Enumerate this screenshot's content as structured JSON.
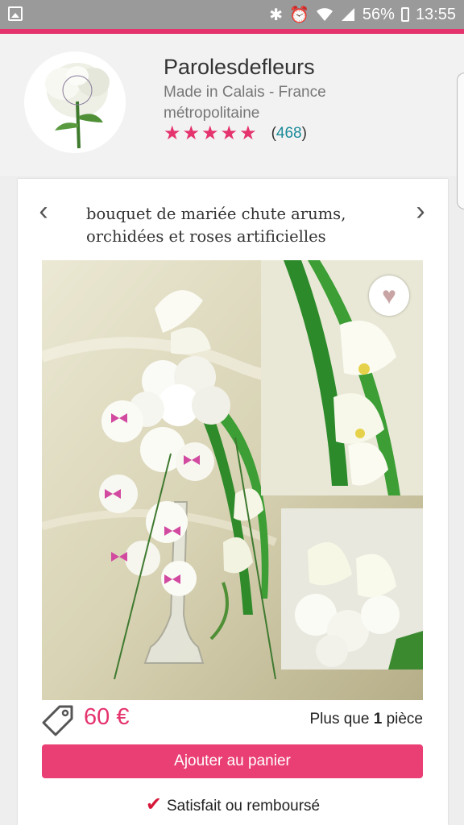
{
  "status_bar": {
    "battery": "56%",
    "time": "13:55"
  },
  "shop": {
    "name": "Parolesdefleurs",
    "location": "Made in Calais - France métropolitaine",
    "rating_stars": 5,
    "review_count": "468",
    "review_open": "(",
    "review_close": ")"
  },
  "product": {
    "title": "bouquet de mariée chute arums, orchidées et roses artificielles",
    "price": "60 €",
    "stock_prefix": "Plus que ",
    "stock_count": "1",
    "stock_suffix": " pièce",
    "add_to_cart": "Ajouter au panier",
    "guarantee": "Satisfait ou remboursé"
  },
  "icons": {
    "gallery": "gallery-icon",
    "bluetooth": "bluetooth-icon",
    "alarm": "alarm-icon",
    "wifi": "wifi-icon",
    "signal": "signal-icon",
    "star": "star-icon",
    "prev": "chevron-left-icon",
    "next": "chevron-right-icon",
    "favorite": "heart-icon",
    "price_tag": "tag-icon",
    "check": "checkmark-icon"
  },
  "colors": {
    "accent": "#e5336d",
    "link": "#1a8a9a",
    "check": "#d6183a"
  }
}
